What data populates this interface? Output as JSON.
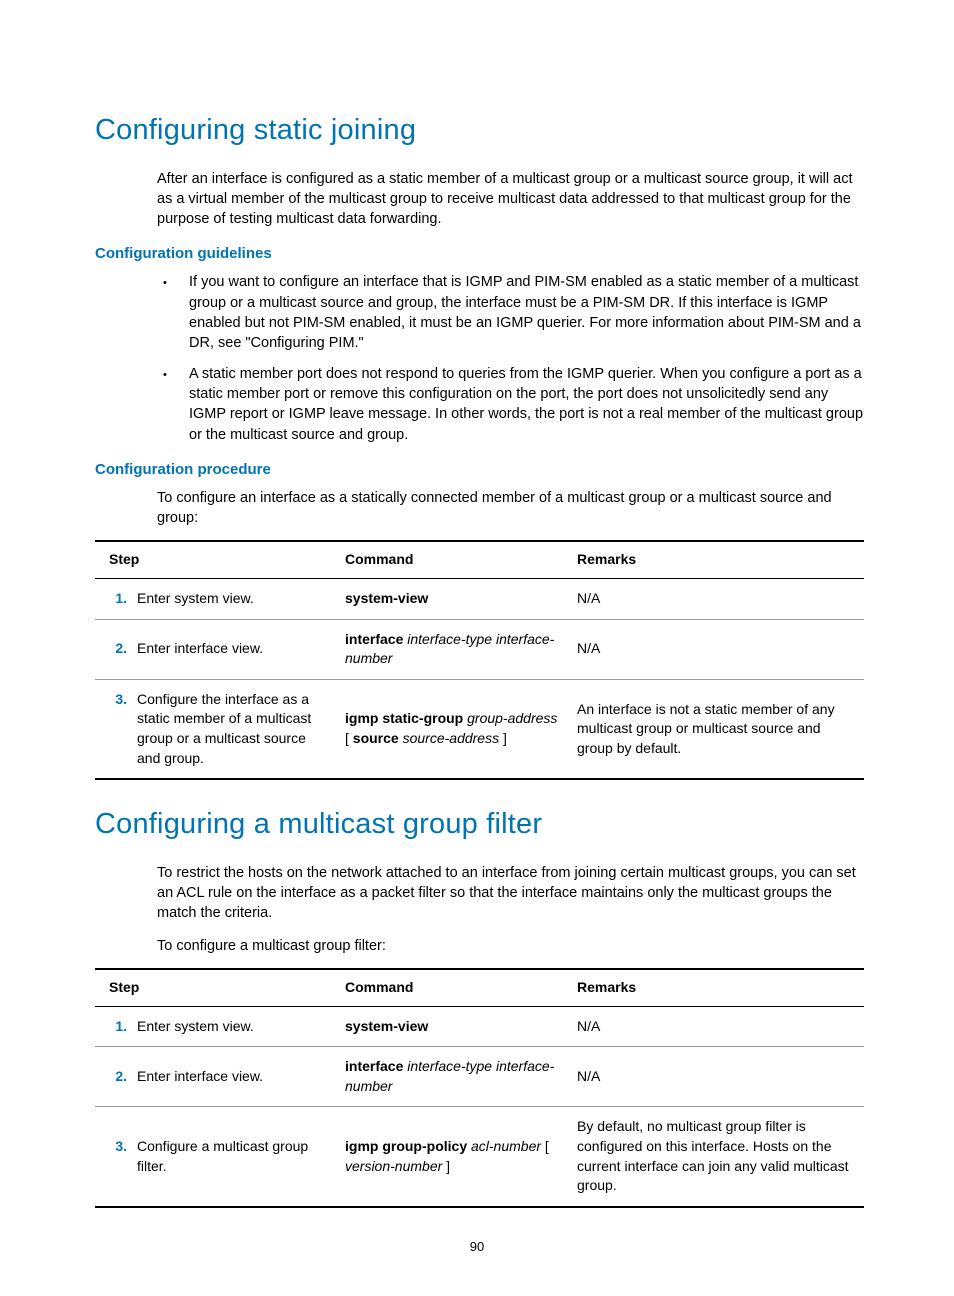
{
  "section1": {
    "title": "Configuring static joining",
    "intro": "After an interface is configured as a static member of a multicast group or a multicast source group, it will act as a virtual member of the multicast group to receive multicast data addressed to that multicast group for the purpose of testing multicast data forwarding.",
    "guidelines_h": "Configuration guidelines",
    "bullets": [
      "If you want to configure an interface that is IGMP and PIM-SM enabled as a static member of a multicast group or a multicast source and group, the interface must be a PIM-SM DR. If this interface is IGMP enabled but not PIM-SM enabled, it must be an IGMP querier. For more information about PIM-SM and a DR, see \"Configuring PIM.\"",
      "A static member port does not respond to queries from the IGMP querier. When you configure a port as a static member port or remove this configuration on the port, the port does not unsolicitedly send any IGMP report or IGMP leave message. In other words, the port is not a real member of the multicast group or the multicast source and group."
    ],
    "procedure_h": "Configuration procedure",
    "procedure_intro": "To configure an interface as a statically connected member of a multicast group or a multicast source and group:",
    "table": {
      "head": {
        "step": "Step",
        "command": "Command",
        "remarks": "Remarks"
      },
      "rows": [
        {
          "n": "1.",
          "desc": "Enter system view.",
          "cmd": [
            {
              "b": "system-view"
            }
          ],
          "rem": "N/A"
        },
        {
          "n": "2.",
          "desc": "Enter interface view.",
          "cmd": [
            {
              "b": "interface "
            },
            {
              "i": "interface-type interface-number"
            }
          ],
          "rem": "N/A"
        },
        {
          "n": "3.",
          "desc": "Configure the interface as a static member of a multicast group or a multicast source and group.",
          "cmd": [
            {
              "b": "igmp static-group "
            },
            {
              "i": "group-address"
            },
            {
              "t": " [ "
            },
            {
              "b": "source"
            },
            {
              "t": " "
            },
            {
              "i": "source-address"
            },
            {
              "t": " ]"
            }
          ],
          "rem": "An interface is not a static member of any multicast group or multicast source and group by default."
        }
      ]
    }
  },
  "section2": {
    "title": "Configuring a multicast group filter",
    "intro": "To restrict the hosts on the network attached to an interface from joining certain multicast groups, you can set an ACL rule on the interface as a packet filter so that the interface maintains only the multicast groups the match the criteria.",
    "intro2": "To configure a multicast group filter:",
    "table": {
      "head": {
        "step": "Step",
        "command": "Command",
        "remarks": "Remarks"
      },
      "rows": [
        {
          "n": "1.",
          "desc": "Enter system view.",
          "cmd": [
            {
              "b": "system-view"
            }
          ],
          "rem": "N/A"
        },
        {
          "n": "2.",
          "desc": "Enter interface view.",
          "cmd": [
            {
              "b": "interface "
            },
            {
              "i": "interface-type interface-number"
            }
          ],
          "rem": "N/A"
        },
        {
          "n": "3.",
          "desc": "Configure a multicast group filter.",
          "cmd": [
            {
              "b": "igmp group-policy "
            },
            {
              "i": "acl-number"
            },
            {
              "t": " [ "
            },
            {
              "i": "version-number"
            },
            {
              "t": " ]"
            }
          ],
          "rem": "By default, no multicast group filter is configured on this interface. Hosts on the current interface can join any valid multicast group."
        }
      ]
    }
  },
  "pagenum": "90"
}
